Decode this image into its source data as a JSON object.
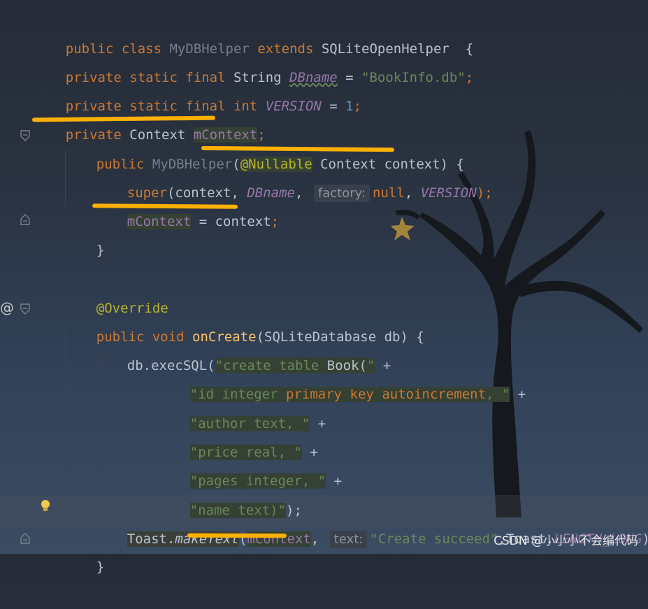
{
  "watermark": "CSDN @小小小不会编代码",
  "hints": {
    "factory": "factory:",
    "text": "text:"
  },
  "code": {
    "l1": {
      "a": "public class ",
      "b": "MyDBHelper",
      "c": " extends ",
      "d": "SQLiteOpenHelper",
      "e": "  {"
    },
    "l2": {
      "a": "private static final ",
      "b": "String ",
      "c": "DBname",
      "d": " = ",
      "e": "\"BookInfo.db\"",
      "f": ";"
    },
    "l3": {
      "a": "private static final int ",
      "b": "VERSION",
      "c": " = ",
      "d": "1",
      "e": ";"
    },
    "l4": {
      "a": "private ",
      "b": "Context ",
      "c": "mContext",
      "d": ";"
    },
    "l5": {
      "a": "public ",
      "b": "MyDBHelper",
      "c": "(",
      "d": "@Nullable",
      "e": " Context context) {"
    },
    "l6": {
      "a": "super",
      "b": "(context, ",
      "c": "DBname",
      "d": ", ",
      "e": "null",
      "f": ", ",
      "g": "VERSION",
      "h": ");"
    },
    "l7": {
      "a": "mContext",
      "b": " = context",
      "c": ";"
    },
    "l8": "}",
    "l9": "@Override",
    "l10": {
      "a": "public void ",
      "b": "onCreate",
      "c": "(SQLiteDatabase db) {"
    },
    "l11": {
      "a": "db.execSQL(",
      "b": "\"create table ",
      "c": "Book(",
      "d": "\"",
      "e": " +"
    },
    "l12": {
      "a": "\"id integer ",
      "b": "primary key autoincrement",
      "c": ", \"",
      "d": " +"
    },
    "l13": {
      "a": "\"author text, \"",
      "b": " +"
    },
    "l14": {
      "a": "\"price real, \"",
      "b": " +"
    },
    "l15": {
      "a": "\"pages integer, \"",
      "b": " +"
    },
    "l16": {
      "a": "\"name text)\"",
      "b": ");"
    },
    "l17": {
      "a": "Toast.",
      "b": "makeText",
      "c": "(",
      "d": "mContext",
      "e": ", ",
      "f": "\"Create succeed\"",
      "g": ",Toast.",
      "h": "LENGTH_LONG",
      "i": ")",
      "j": ";"
    },
    "l18": "}"
  }
}
